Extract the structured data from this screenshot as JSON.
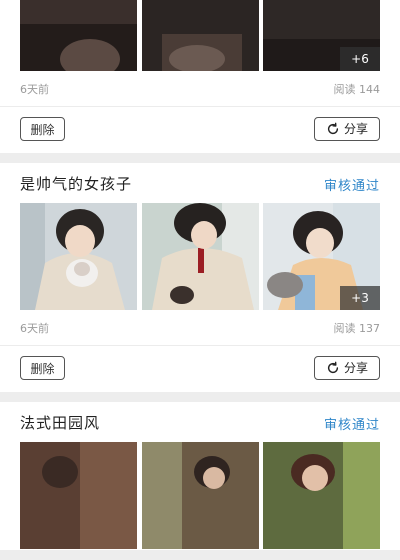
{
  "posts": [
    {
      "title": "",
      "status": "",
      "more_count": "+6",
      "date": "6天前",
      "reads": "阅读 144",
      "delete_label": "删除",
      "share_label": "分享"
    },
    {
      "title": "是帅气的女孩子",
      "status": "审核通过",
      "more_count": "+3",
      "date": "6天前",
      "reads": "阅读 137",
      "delete_label": "删除",
      "share_label": "分享"
    },
    {
      "title": "法式田园风",
      "status": "审核通过",
      "more_count": "",
      "date": "",
      "reads": "",
      "delete_label": "",
      "share_label": ""
    }
  ],
  "colors": {
    "background": "#ededed",
    "card": "#ffffff",
    "status": "#2f86c9",
    "muted_text": "#9a9a9a"
  },
  "icons": {
    "share": "refresh-share-icon"
  }
}
